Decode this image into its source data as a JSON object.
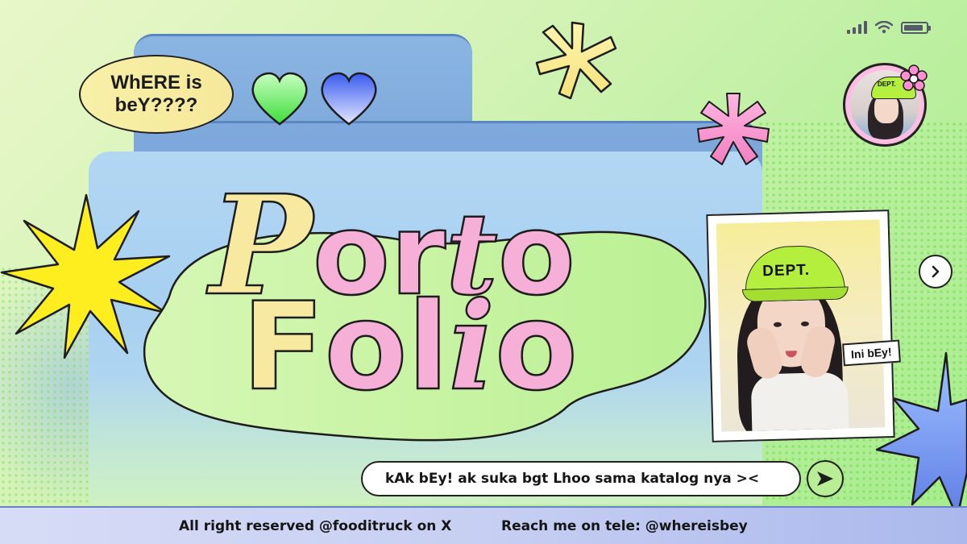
{
  "status_bar": {
    "battery_level": 0.9,
    "signal_bars": 4
  },
  "sticker": {
    "line1": "WhERE is",
    "line2": "beY????"
  },
  "title": {
    "word1": [
      "P",
      "o",
      "r",
      "t",
      "o"
    ],
    "word2": [
      "F",
      "o",
      "l",
      "i",
      "o"
    ]
  },
  "avatar": {
    "cap_text": "DEPT."
  },
  "photo": {
    "cap_text": "DEPT.",
    "tag": "Ini bEy!"
  },
  "message": {
    "text": "kAk bEy! ak suka bgt Lhoo sama katalog nya ><"
  },
  "footer": {
    "left": "All right reserved @fooditruck on X",
    "right": "Reach me on tele: @whereisbey"
  },
  "colors": {
    "pink": "#f6b0d8",
    "yellow": "#f7eaa0",
    "folder_blue": "#7aa6d8",
    "green_accent": "#b9ee97"
  }
}
